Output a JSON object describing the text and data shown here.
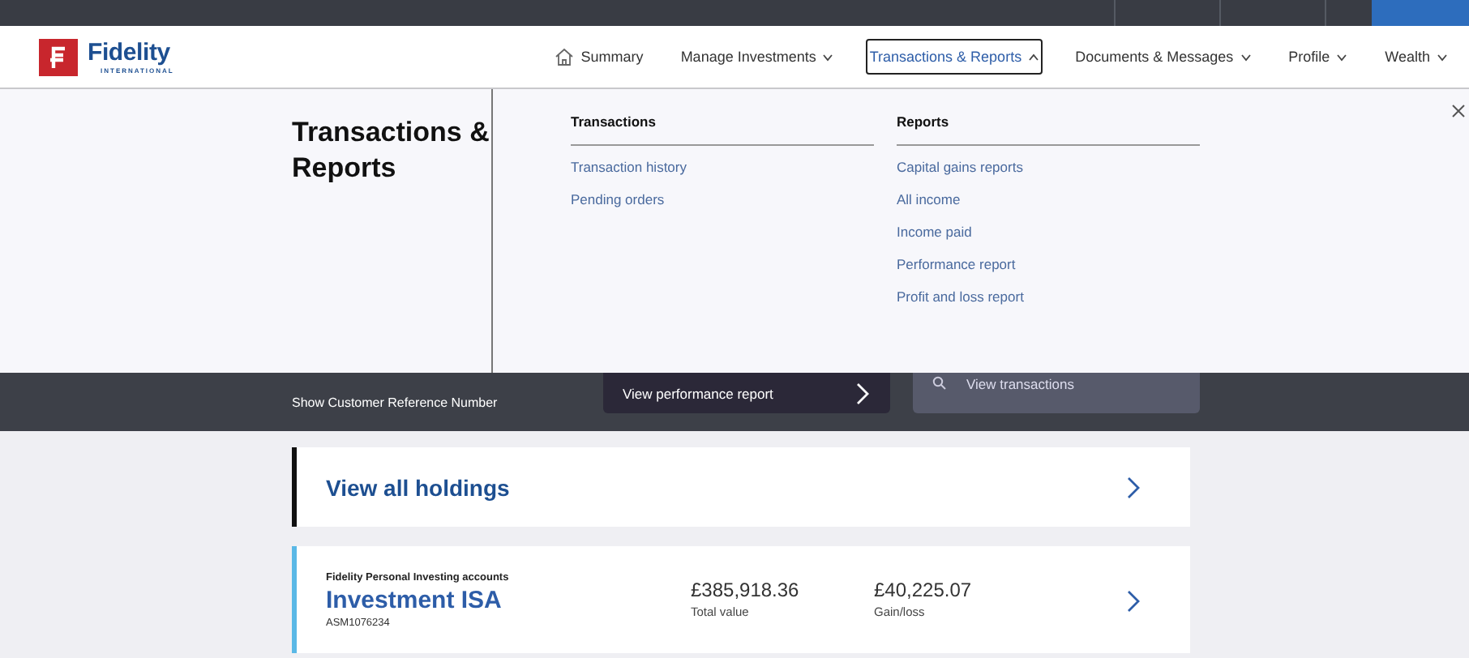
{
  "header": {
    "logo": {
      "name": "Fidelity",
      "subtitle": "INTERNATIONAL"
    },
    "nav": [
      {
        "label": "Summary",
        "kind": "home",
        "selected": false
      },
      {
        "label": "Manage Investments",
        "kind": "dropdown",
        "selected": false,
        "expanded": false
      },
      {
        "label": "Transactions & Reports",
        "kind": "dropdown",
        "selected": true,
        "expanded": true
      },
      {
        "label": "Documents & Messages",
        "kind": "dropdown",
        "selected": false,
        "expanded": false
      },
      {
        "label": "Profile",
        "kind": "dropdown",
        "selected": false,
        "expanded": false
      },
      {
        "label": "Wealth",
        "kind": "dropdown",
        "selected": false,
        "expanded": false
      }
    ]
  },
  "menu": {
    "title": "Transactions & Reports",
    "columns": [
      {
        "heading": "Transactions",
        "links": [
          "Transaction history",
          "Pending orders"
        ]
      },
      {
        "heading": "Reports",
        "links": [
          "Capital gains reports",
          "All income",
          "Income paid",
          "Performance report",
          "Profit and loss report"
        ]
      }
    ]
  },
  "band": {
    "label": "Show Customer Reference Number",
    "actions": [
      {
        "label": "View performance report",
        "kind": "primary"
      },
      {
        "label": "View transactions",
        "kind": "secondary"
      }
    ]
  },
  "holdings": {
    "label": "View all holdings"
  },
  "accounts": [
    {
      "provider": "Fidelity Personal Investing accounts",
      "name": "Investment ISA",
      "number": "ASM1076234",
      "stats": [
        {
          "value": "£385,918.36",
          "label": "Total value"
        },
        {
          "value": "£40,225.07",
          "label": "Gain/loss"
        }
      ]
    }
  ]
}
